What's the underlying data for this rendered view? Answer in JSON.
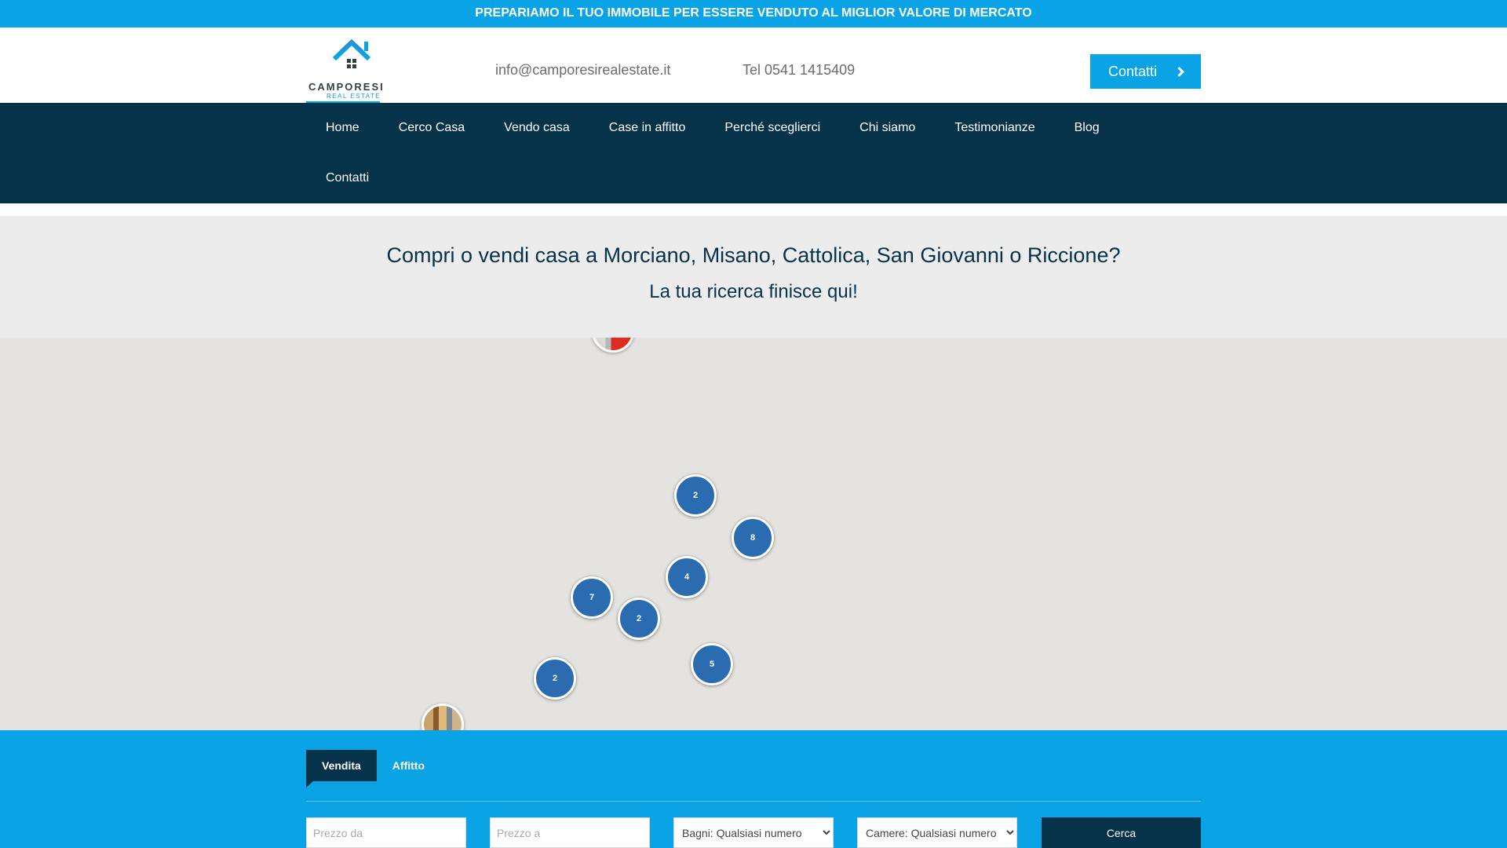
{
  "topbar": {
    "text": "PREPARIAMO IL TUO IMMOBILE PER ESSERE VENDUTO AL MIGLIOR VALORE DI MERCATO"
  },
  "header": {
    "logo": {
      "brand": "CAMPORESI",
      "sub": "REAL ESTATE"
    },
    "email": "info@camporesirealestate.it",
    "phone": "Tel 0541 1415409",
    "contact_button": "Contatti"
  },
  "nav": {
    "items": [
      {
        "label": "Home"
      },
      {
        "label": "Cerco Casa"
      },
      {
        "label": "Vendo casa"
      },
      {
        "label": "Case in affitto"
      },
      {
        "label": "Perché sceglierci"
      },
      {
        "label": "Chi siamo"
      },
      {
        "label": "Testimonianze"
      },
      {
        "label": "Blog"
      },
      {
        "label": "Contatti"
      }
    ]
  },
  "hero": {
    "title": "Compri o vendi casa a Morciano, Misano, Cattolica, San Giovanni o Riccione?",
    "subtitle": "La tua ricerca finisce qui!"
  },
  "map": {
    "clusters": [
      "2",
      "8",
      "4",
      "7",
      "2",
      "5",
      "2"
    ],
    "colors": {
      "cluster": "#2b6cb0",
      "background": "#e5e3df"
    }
  },
  "search": {
    "tabs": [
      {
        "label": "Vendita",
        "active": true
      },
      {
        "label": "Affitto",
        "active": false
      }
    ],
    "price_from_placeholder": "Prezzo da",
    "price_to_placeholder": "Prezzo a",
    "bathrooms_selected": "Bagni: Qualsiasi numero",
    "rooms_selected": "Camere: Qualsiasi numero",
    "submit": "Cerca"
  },
  "colors": {
    "accent": "#0aa3e6",
    "dark": "#06324a"
  }
}
